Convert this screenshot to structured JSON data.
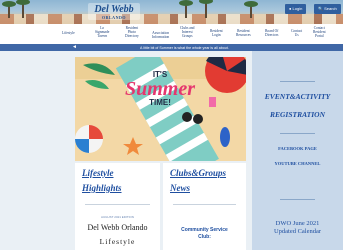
{
  "header": {
    "logo_text": "Del Webb",
    "logo_sub": "ORLANDO",
    "login_label": "● Login",
    "search_label": "🔍 Search"
  },
  "nav": {
    "items": [
      "Lifestyle",
      "Lo\nSignmade\nTavern",
      "Resident\nPhoto\nDirectory",
      "Association\nInformation",
      "Clubs and\nInterest\nGroups",
      "Resident\nLogin",
      "Resident\nResources",
      "Board Of\nDirectors",
      "Contact\nUs",
      "Contact\nResident\nPortal"
    ]
  },
  "announcement": {
    "text": "A little bit of Summer is what the whole year is all about."
  },
  "hero": {
    "its": "IT'S",
    "summer": "Summer",
    "time": "TIME!"
  },
  "lifestyle": {
    "title_line1": "Lifestyle",
    "title_line2": "Highlights",
    "small": "AUGUST 2021 EDITION",
    "name": "Del Webb Orlando",
    "sub": "Lifestyle"
  },
  "clubs": {
    "title_line1": "Clubs&Groups",
    "title_line2": "News",
    "item_line1": "Community Service",
    "item_line2": "Club:"
  },
  "sidebar": {
    "event_line": "EVENT&ACTIVITY",
    "registration": "REGISTRATION",
    "facebook": "FACEBOOK PAGE",
    "youtube": "YOUTUBE CHANNEL",
    "dwo_line1": "DWO June 2021",
    "dwo_line2": "Updated Calendar"
  },
  "colors": {
    "accent_blue": "#1f4fa0",
    "announce_bar": "#3f67a6",
    "sidebar_bg": "#c8d8ea"
  }
}
